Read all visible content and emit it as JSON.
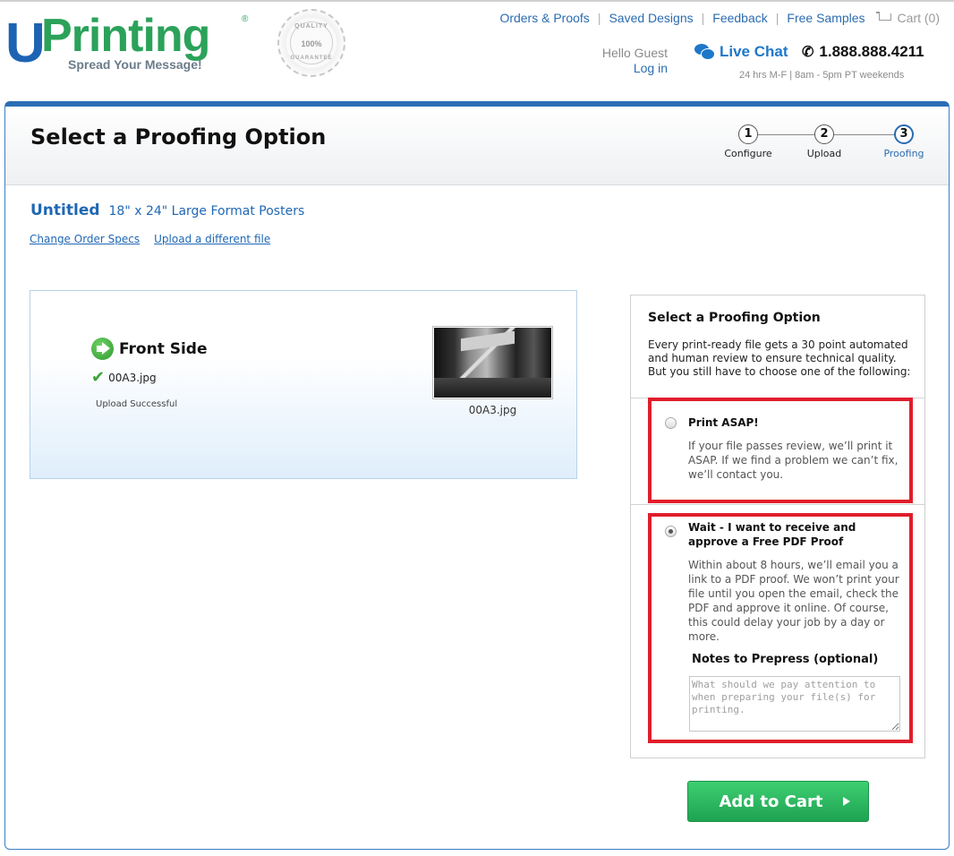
{
  "brand": {
    "letter": "U",
    "name": "Printing",
    "registered": "®",
    "tagline": "Spread Your Message!",
    "seal_top": "QUALITY",
    "seal_mid": "100%",
    "seal_bottom": "GUARANTEE"
  },
  "topnav": {
    "items": [
      "Orders & Proofs",
      "Saved Designs",
      "Feedback",
      "Free Samples"
    ],
    "cart_label": "Cart (0)"
  },
  "account": {
    "greeting": "Hello Guest",
    "login": "Log in"
  },
  "support": {
    "live_chat": "Live Chat",
    "phone": "1.888.888.4211",
    "hours": "24 hrs M-F | 8am - 5pm PT weekends"
  },
  "page": {
    "title": "Select a Proofing Option"
  },
  "steps": [
    {
      "num": "1",
      "label": "Configure"
    },
    {
      "num": "2",
      "label": "Upload"
    },
    {
      "num": "3",
      "label": "Proofing"
    }
  ],
  "product": {
    "name": "Untitled",
    "size": "18\" x 24\" Large Format Posters",
    "change_specs": "Change Order Specs",
    "upload_different": "Upload a different file"
  },
  "upload": {
    "side": "Front Side",
    "file_name": "00A3.jpg",
    "status": "Upload Successful",
    "thumb_caption": "00A3.jpg"
  },
  "proofing": {
    "title": "Select a Proofing Option",
    "intro": "Every print-ready file gets a 30 point automated and human review to ensure technical quality. But you still have to choose one of the following:",
    "option1": {
      "label": "Print ASAP!",
      "desc": "If your file passes review, we’ll print it ASAP. If we find a problem we can’t fix, we’ll contact you.",
      "selected": false
    },
    "option2": {
      "label": "Wait - I want to receive and approve a Free PDF Proof",
      "desc": "Within about 8 hours, we’ll email you a link to a PDF proof. We won’t print your file until you open the email, check the PDF and approve it online. Of course, this could delay your job by a day or more.",
      "selected": true
    },
    "notes_label": "Notes to Prepress (optional)",
    "notes_placeholder": "What should we pay attention to when preparing your file(s) for printing.",
    "notes_value": ""
  },
  "cta": {
    "add_to_cart": "Add to Cart"
  },
  "colors": {
    "brand_blue": "#1d63b4",
    "brand_green": "#2ba25a",
    "highlight_red": "#e01e2c",
    "cta_green": "#1ea352"
  }
}
